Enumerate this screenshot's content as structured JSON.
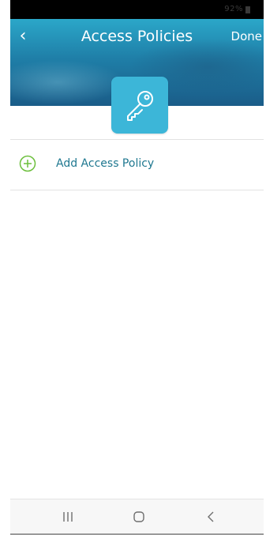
{
  "status_bar": {
    "text": "92%"
  },
  "header": {
    "back_label": "‹",
    "title": "Access Policies",
    "done_label": "Done"
  },
  "list": {
    "add_label": "Add Access Policy"
  },
  "icons": {
    "hero": "key-icon",
    "add": "add-circle-icon"
  },
  "colors": {
    "header_top": "#2ba7c9",
    "header_bottom": "#1a5c88",
    "tile": "#3cb6d8",
    "add_icon": "#6cbf3c",
    "link_text": "#1f7890"
  }
}
